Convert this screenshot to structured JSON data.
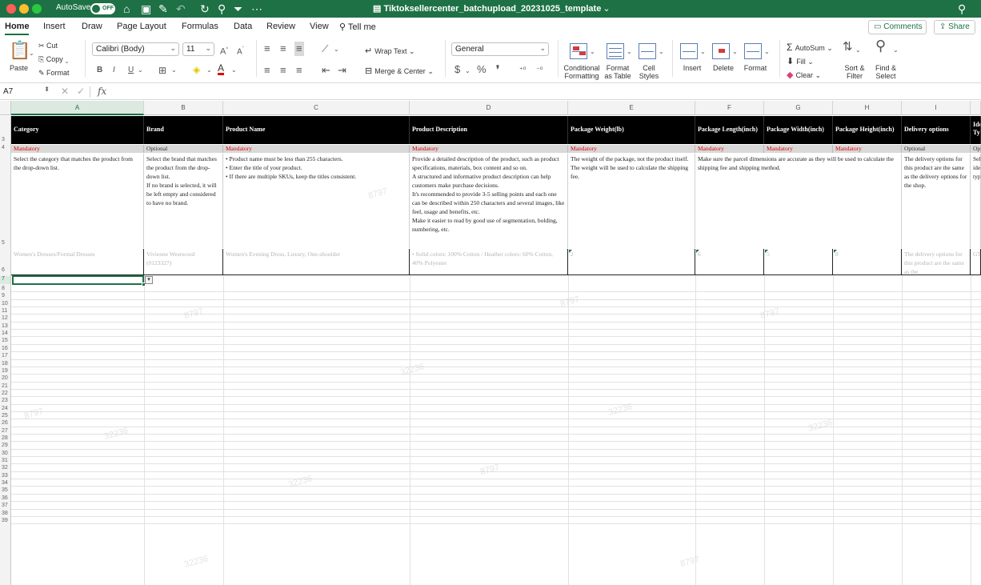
{
  "titlebar": {
    "autosave_label": "AutoSave",
    "toggle_state": "OFF",
    "document_title": "Tiktoksellercenter_batchupload_20231025_template",
    "chevron": "⌄"
  },
  "tabs": [
    "Home",
    "Insert",
    "Draw",
    "Page Layout",
    "Formulas",
    "Data",
    "Review",
    "View"
  ],
  "tell_me": "Tell me",
  "comments_label": "Comments",
  "share_label": "Share",
  "ribbon": {
    "paste": "Paste",
    "cut": "Cut",
    "copy": "Copy",
    "format": "Format",
    "font_name": "Calibri (Body)",
    "font_size": "11",
    "bold": "B",
    "italic": "I",
    "underline": "U",
    "wrap_text": "Wrap Text",
    "merge_center": "Merge & Center",
    "number_format": "General",
    "currency": "$",
    "percent": "%",
    "comma": "❜",
    "conditional_formatting": [
      "Conditional",
      "Formatting"
    ],
    "format_as_table": [
      "Format",
      "as Table"
    ],
    "cell_styles": [
      "Cell",
      "Styles"
    ],
    "insert": "Insert",
    "delete": "Delete",
    "format_cells": "Format",
    "autosum": "AutoSum",
    "fill": "Fill",
    "clear": "Clear",
    "sort_filter": [
      "Sort &",
      "Filter"
    ],
    "find_select": [
      "Find &",
      "Select"
    ]
  },
  "formula_bar": {
    "name_box": "A7",
    "fx": "fx"
  },
  "columns": [
    "A",
    "B",
    "C",
    "D",
    "E",
    "F",
    "G",
    "H",
    "I"
  ],
  "selected_column": "A",
  "header_row": [
    "Category",
    "Brand",
    "Product Name",
    "Product Description",
    "Package Weight(lb)",
    "Package Length(inch)",
    "Package Width(inch)",
    "Package Height(inch)",
    "Delivery options",
    "Ide Ty"
  ],
  "requirement_row": [
    "Mandatory",
    "Optional",
    "Mandatory",
    "Mandatory",
    "Mandatory",
    "Mandatory",
    "Mandatory",
    "Mandatory",
    "Optional",
    "Op"
  ],
  "description_row": [
    "Select the category that matches the product from the drop-down list.",
    "Select the brand that matches the product from the drop-down list.\nIf no brand is selected, it will be left empty and considered to have no brand.",
    "• Product name must be less than 255 characters.\n• Enter the title of your product.\n• If there are multiple SKUs, keep the titles consistent.",
    "Provide a detailed description of the product, such as product specifications, materials, box content and so on.\nA structured and informative product description can help customers make purchase decisions.\nIt's recommended to provide 3-5 selling points and each one can be described within 250 characters and several images, like feel, usage and benefits, etc.\nMake it easier to read by good use of segmentation, bolding, numbering, etc.",
    "The weight of the package, not the product itself.\nThe weight will be used to calculate the shipping fee.",
    "Make sure the parcel dimensions are accurate as they will be used to calculate the shipping fee and shipping method.",
    "",
    "",
    "The delivery options for this product are the same as the delivery options for the shop.",
    "Sel ide typ"
  ],
  "example_row": [
    "Women's Dresses/Formal Dresses",
    "Vivienne Westwood (0123327)",
    "Women's Evening Dress, Luxury, One-shoulder",
    "• Solid colors: 100% Cotton / Heather colors: 60% Cotton, 40% Polyester",
    "2",
    "6",
    "5",
    "8",
    "The delivery options for this product are the same as the",
    "GT"
  ],
  "row_numbers": [
    "3",
    "4",
    "5",
    "6",
    "7",
    "8",
    "9",
    "10",
    "11",
    "12",
    "13",
    "14",
    "15",
    "16",
    "17",
    "18",
    "19",
    "20",
    "21",
    "22",
    "23",
    "24",
    "25",
    "26",
    "27",
    "28",
    "29",
    "30",
    "31",
    "32",
    "33",
    "34",
    "35",
    "36",
    "37",
    "38",
    "39"
  ],
  "selected_row": "7",
  "watermarks": [
    "8797",
    "32236",
    "8797",
    "32236"
  ],
  "colors": {
    "excel_green": "#1e7145",
    "mandatory_red": "#e00000",
    "header_black": "#000000",
    "requirement_gray": "#d9d9d9"
  }
}
